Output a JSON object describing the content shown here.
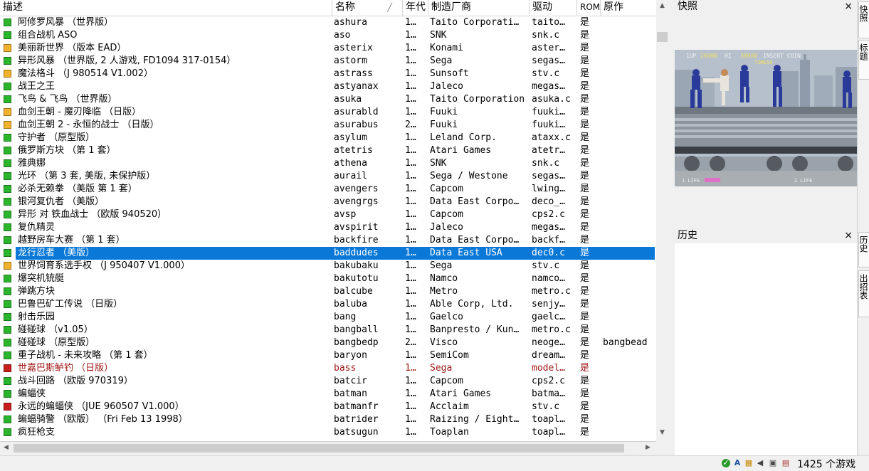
{
  "columns": {
    "desc": "描述",
    "name": "名称",
    "year": "年代",
    "maker": "制造厂商",
    "driver": "驱动",
    "rom": "ROM",
    "parent": "原作"
  },
  "colors": {
    "green": "#2bb52b",
    "yellow": "#f0b22b",
    "red": "#c81e1e",
    "selection": "#0a78d7"
  },
  "rows": [
    {
      "icon": "green",
      "desc": "阿修罗风暴 （世界版）",
      "name": "ashura",
      "year": "1…",
      "maker": "Taito Corporati…",
      "driver": "taito…",
      "rom": "是",
      "parent": ""
    },
    {
      "icon": "green",
      "desc": "组合战机 ASO",
      "name": "aso",
      "year": "1…",
      "maker": "SNK",
      "driver": "snk.c",
      "rom": "是",
      "parent": ""
    },
    {
      "icon": "yellow",
      "desc": "美丽新世界 （版本 EAD）",
      "name": "asterix",
      "year": "1…",
      "maker": "Konami",
      "driver": "aster…",
      "rom": "是",
      "parent": ""
    },
    {
      "icon": "green",
      "desc": "异形风暴 （世界版, 2 人游戏, FD1094 317-0154）",
      "name": "astorm",
      "year": "1…",
      "maker": "Sega",
      "driver": "segas…",
      "rom": "是",
      "parent": ""
    },
    {
      "icon": "yellow",
      "desc": "魔法格斗 （J 980514 V1.002）",
      "name": "astrass",
      "year": "1…",
      "maker": "Sunsoft",
      "driver": "stv.c",
      "rom": "是",
      "parent": ""
    },
    {
      "icon": "green",
      "desc": "战王之王",
      "name": "astyanax",
      "year": "1…",
      "maker": "Jaleco",
      "driver": "megas…",
      "rom": "是",
      "parent": ""
    },
    {
      "icon": "green",
      "desc": "飞鸟 & 飞鸟 （世界版）",
      "name": "asuka",
      "year": "1…",
      "maker": "Taito Corporation",
      "driver": "asuka.c",
      "rom": "是",
      "parent": ""
    },
    {
      "icon": "yellow",
      "desc": "血剑王朝 - 魔刃降临 （日版）",
      "name": "asurabld",
      "year": "1…",
      "maker": "Fuuki",
      "driver": "fuuki…",
      "rom": "是",
      "parent": ""
    },
    {
      "icon": "yellow",
      "desc": "血剑王朝 2 - 永恒的战士 （日版）",
      "name": "asurabus",
      "year": "2…",
      "maker": "Fuuki",
      "driver": "fuuki…",
      "rom": "是",
      "parent": ""
    },
    {
      "icon": "green",
      "desc": "守护者 （原型版）",
      "name": "asylum",
      "year": "1…",
      "maker": "Leland Corp.",
      "driver": "ataxx.c",
      "rom": "是",
      "parent": ""
    },
    {
      "icon": "green",
      "desc": "俄罗斯方块 （第 1 套）",
      "name": "atetris",
      "year": "1…",
      "maker": "Atari Games",
      "driver": "atetr…",
      "rom": "是",
      "parent": ""
    },
    {
      "icon": "green",
      "desc": "雅典娜",
      "name": "athena",
      "year": "1…",
      "maker": "SNK",
      "driver": "snk.c",
      "rom": "是",
      "parent": ""
    },
    {
      "icon": "green",
      "desc": "光环 （第 3 套, 美版, 未保护版）",
      "name": "aurail",
      "year": "1…",
      "maker": "Sega / Westone",
      "driver": "segas…",
      "rom": "是",
      "parent": ""
    },
    {
      "icon": "green",
      "desc": "必杀无赖拳 （美版 第 1 套）",
      "name": "avengers",
      "year": "1…",
      "maker": "Capcom",
      "driver": "lwing…",
      "rom": "是",
      "parent": ""
    },
    {
      "icon": "green",
      "desc": "银河复仇者 （美版）",
      "name": "avengrgs",
      "year": "1…",
      "maker": "Data East Corpo…",
      "driver": "deco_…",
      "rom": "是",
      "parent": ""
    },
    {
      "icon": "green",
      "desc": "异形 对 铁血战士 （欧版 940520）",
      "name": "avsp",
      "year": "1…",
      "maker": "Capcom",
      "driver": "cps2.c",
      "rom": "是",
      "parent": ""
    },
    {
      "icon": "green",
      "desc": "复仇精灵",
      "name": "avspirit",
      "year": "1…",
      "maker": "Jaleco",
      "driver": "megas…",
      "rom": "是",
      "parent": ""
    },
    {
      "icon": "green",
      "desc": "越野房车大赛 （第 1 套）",
      "name": "backfire",
      "year": "1…",
      "maker": "Data East Corpo…",
      "driver": "backf…",
      "rom": "是",
      "parent": ""
    },
    {
      "icon": "green",
      "desc": "龙行忍者 （美版）",
      "name": "baddudes",
      "year": "1…",
      "maker": "Data East USA",
      "driver": "dec0.c",
      "rom": "是",
      "parent": "",
      "selected": true
    },
    {
      "icon": "yellow",
      "desc": "世界饲育系选手权 （J 950407 V1.000）",
      "name": "bakubaku",
      "year": "1…",
      "maker": "Sega",
      "driver": "stv.c",
      "rom": "是",
      "parent": ""
    },
    {
      "icon": "green",
      "desc": "爆突机铳艇",
      "name": "bakutotu",
      "year": "1…",
      "maker": "Namco",
      "driver": "namco…",
      "rom": "是",
      "parent": ""
    },
    {
      "icon": "green",
      "desc": "弹跳方块",
      "name": "balcube",
      "year": "1…",
      "maker": "Metro",
      "driver": "metro.c",
      "rom": "是",
      "parent": ""
    },
    {
      "icon": "green",
      "desc": "巴鲁巴矿工传说 （日版）",
      "name": "baluba",
      "year": "1…",
      "maker": "Able Corp, Ltd.",
      "driver": "senjy…",
      "rom": "是",
      "parent": ""
    },
    {
      "icon": "green",
      "desc": "射击乐园",
      "name": "bang",
      "year": "1…",
      "maker": "Gaelco",
      "driver": "gaelc…",
      "rom": "是",
      "parent": ""
    },
    {
      "icon": "green",
      "desc": "碰碰球 （v1.05）",
      "name": "bangball",
      "year": "1…",
      "maker": "Banpresto / Kun…",
      "driver": "metro.c",
      "rom": "是",
      "parent": ""
    },
    {
      "icon": "green",
      "desc": "碰碰球 （原型版）",
      "name": "bangbedp",
      "year": "2…",
      "maker": "Visco",
      "driver": "neoge…",
      "rom": "是",
      "parent": "bangbead"
    },
    {
      "icon": "green",
      "desc": "重子战机 - 未来攻略 （第 1 套）",
      "name": "baryon",
      "year": "1…",
      "maker": "SemiCom",
      "driver": "dream…",
      "rom": "是",
      "parent": ""
    },
    {
      "icon": "red",
      "desc": "世嘉巴斯鲈钓 （日版）",
      "name": "bass",
      "year": "1…",
      "maker": "Sega",
      "driver": "model…",
      "rom": "是",
      "parent": "",
      "bad": true
    },
    {
      "icon": "green",
      "desc": "战斗回路 （欧版 970319）",
      "name": "batcir",
      "year": "1…",
      "maker": "Capcom",
      "driver": "cps2.c",
      "rom": "是",
      "parent": ""
    },
    {
      "icon": "green",
      "desc": "蝙蝠侠",
      "name": "batman",
      "year": "1…",
      "maker": "Atari Games",
      "driver": "batma…",
      "rom": "是",
      "parent": ""
    },
    {
      "icon": "red",
      "desc": "永远的蝙蝠侠 （JUE 960507 V1.000）",
      "name": "batmanfr",
      "year": "1…",
      "maker": "Acclaim",
      "driver": "stv.c",
      "rom": "是",
      "parent": ""
    },
    {
      "icon": "green",
      "desc": "蝙蝠骑警 （欧版） （Fri Feb 13 1998）",
      "name": "batrider",
      "year": "1…",
      "maker": "Raizing / Eight…",
      "driver": "toapl…",
      "rom": "是",
      "parent": ""
    },
    {
      "icon": "green",
      "desc": "疯狂枪支",
      "name": "batsugun",
      "year": "1…",
      "maker": "Toaplan",
      "driver": "toapl…",
      "rom": "是",
      "parent": ""
    }
  ],
  "panels": {
    "snapshot_title": "快照",
    "history_title": "历史",
    "close_glyph": "×",
    "hud": {
      "p1": "1UP",
      "score1": "26900",
      "hi_label": "HI",
      "hi_score": "30000",
      "insert": "INSERT COIN",
      "time": "TIME50",
      "life1": "1 LIFE",
      "life2": "2 LIFE"
    }
  },
  "side_tabs": [
    "快照",
    "标题",
    "历史",
    "出招表"
  ],
  "status": {
    "count_text": "1425 个游戏"
  }
}
